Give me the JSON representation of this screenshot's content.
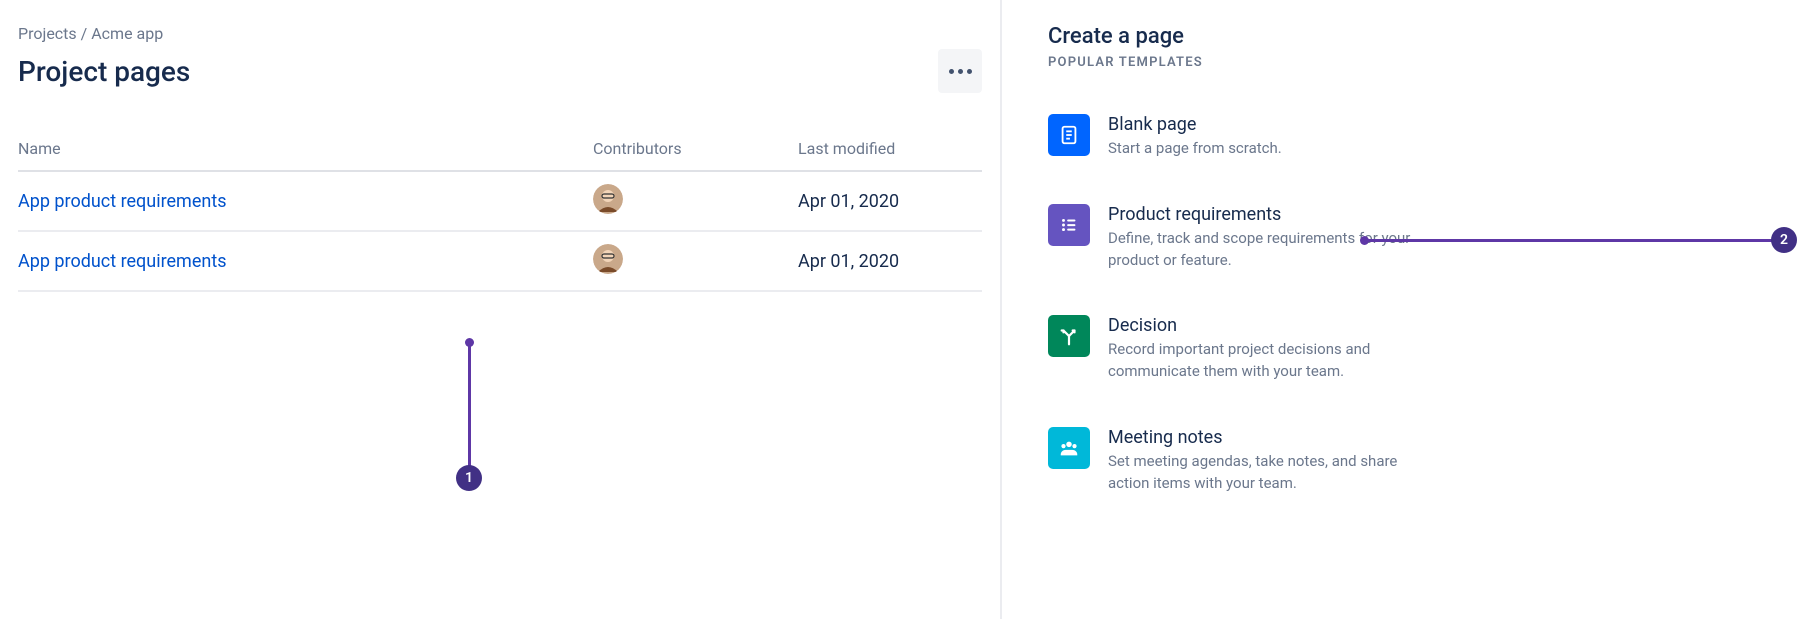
{
  "breadcrumb": {
    "root": "Projects",
    "sep": "/",
    "current": "Acme app"
  },
  "page": {
    "title": "Project pages"
  },
  "table": {
    "headers": {
      "name": "Name",
      "contributors": "Contributors",
      "modified": "Last modified"
    },
    "rows": [
      {
        "name": "App product requirements",
        "modified": "Apr 01, 2020"
      },
      {
        "name": "App product requirements",
        "modified": "Apr 01, 2020"
      }
    ]
  },
  "callouts": {
    "one": "1",
    "two": "2"
  },
  "sidebar": {
    "title": "Create a page",
    "subtitle": "Popular templates",
    "templates": [
      {
        "title": "Blank page",
        "desc": "Start a page from scratch."
      },
      {
        "title": "Product requirements",
        "desc": "Define, track and scope requirements for your product or feature."
      },
      {
        "title": "Decision",
        "desc": "Record important project decisions and communicate them with your team."
      },
      {
        "title": "Meeting notes",
        "desc": "Set meeting agendas, take notes, and share action items with your team."
      }
    ]
  }
}
